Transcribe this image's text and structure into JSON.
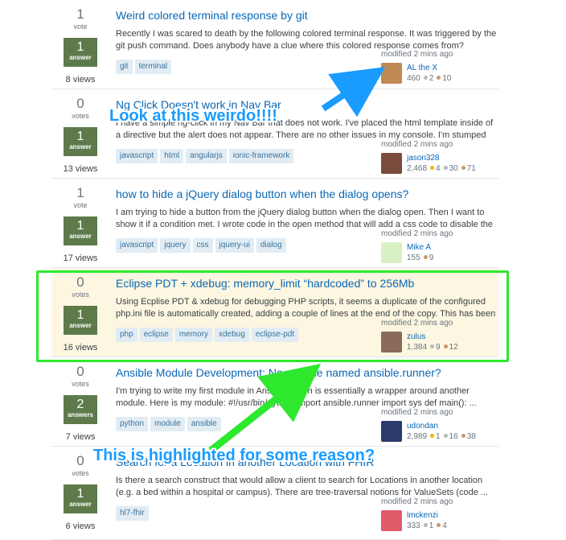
{
  "questions": [
    {
      "votes": "1",
      "votes_label": "vote",
      "answers": "1",
      "answers_label": "answer",
      "views": "8 views",
      "title": "Weird colored terminal response by git",
      "excerpt": "Recently I was scared to death by the following colored terminal response. It was triggered by the git push command. Does anybody have a clue where this colored response comes from?",
      "tags": [
        "git",
        "terminal"
      ],
      "owner": {
        "time": "modified 2 mins ago",
        "name": "AL the X",
        "rep": "460",
        "gold": "",
        "silver": "2",
        "bronze": "10",
        "avatar_color": "#c08a55"
      }
    },
    {
      "votes": "0",
      "votes_label": "votes",
      "answers": "1",
      "answers_label": "answer",
      "views": "13 views",
      "title": "Ng Click Doesn't work in Nav Bar",
      "excerpt": "I have a simple ng-click in my Nav Bar that does not work. I've placed the html template inside of a directive but the alert does not appear. There are no other issues in my console. I'm stumped as ...",
      "tags": [
        "javascript",
        "html",
        "angularjs",
        "ionic-framework"
      ],
      "owner": {
        "time": "modified 2 mins ago",
        "name": "jason328",
        "rep": "2,468",
        "gold": "4",
        "silver": "30",
        "bronze": "71",
        "avatar_color": "#7a4a3a"
      }
    },
    {
      "votes": "1",
      "votes_label": "vote",
      "answers": "1",
      "answers_label": "answer",
      "views": "17 views",
      "title": "how to hide a jQuery dialog button when the dialog opens?",
      "excerpt": "I am trying to hide a button from the jQuery dialog button when the dialog open. Then I want to show it if a condition met. I wrote code in the open method that will add a css code to disable the ...",
      "tags": [
        "javascript",
        "jquery",
        "css",
        "jquery-ui",
        "dialog"
      ],
      "owner": {
        "time": "modified 2 mins ago",
        "name": "Mike A",
        "rep": "155",
        "gold": "",
        "silver": "",
        "bronze": "9",
        "avatar_color": "#d9f0c4"
      }
    },
    {
      "votes": "0",
      "votes_label": "votes",
      "answers": "1",
      "answers_label": "answer",
      "views": "16 views",
      "title": "Eclipse PDT + xdebug: memory_limit “hardcoded” to 256Mb",
      "excerpt": "Using Ecplise PDT & xdebug for debugging PHP scripts, it seems a duplicate of the configured php.ini file is automatically created, adding a couple of lines at the end of the copy. This has been ...",
      "tags": [
        "php",
        "eclipse",
        "memory",
        "xdebug",
        "eclipse-pdt"
      ],
      "owner": {
        "time": "modified 2 mins ago",
        "name": "zulus",
        "rep": "1,384",
        "gold": "",
        "silver": "9",
        "bronze": "12",
        "avatar_color": "#8a6a58"
      }
    },
    {
      "votes": "0",
      "votes_label": "votes",
      "answers": "2",
      "answers_label": "answers",
      "views": "7 views",
      "title": "Ansible Module Development: No module named ansible.runner?",
      "excerpt": "I'm trying to write my first module in Ansible, which is essentially a wrapper around another module. Here is my module: #!/usr/bin/python import ansible.runner import sys def main(): ...",
      "tags": [
        "python",
        "module",
        "ansible"
      ],
      "owner": {
        "time": "modified 2 mins ago",
        "name": "udondan",
        "rep": "2,989",
        "gold": "1",
        "silver": "16",
        "bronze": "38",
        "avatar_color": "#2a3a6a"
      }
    },
    {
      "votes": "0",
      "votes_label": "votes",
      "answers": "1",
      "answers_label": "answer",
      "views": "6 views",
      "title": "Search for a Location in another Location with FHIR",
      "excerpt": "Is there a search construct that would allow a client to search for Locations in another location (e.g. a bed within a hospital or campus). There are tree-traversal notions for ValueSets (code ...",
      "tags": [
        "hl7-fhir"
      ],
      "owner": {
        "time": "modified 2 mins ago",
        "name": "lmckenzi",
        "rep": "333",
        "gold": "",
        "silver": "1",
        "bronze": "4",
        "avatar_color": "#e05a6a"
      }
    }
  ],
  "annotations": {
    "weirdo": "Look at this weirdo!!!!",
    "highlight": "This is highlighted for some reason?"
  },
  "colors": {
    "accent_blue": "#1a9bff",
    "annotation_green": "#2ee82e",
    "answered_green": "#5e7a4a",
    "highlight_bg": "#fdf7e2"
  }
}
